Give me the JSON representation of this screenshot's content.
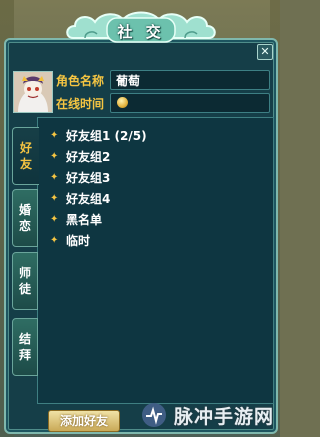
{
  "window": {
    "title": "社 交",
    "close_glyph": "✕"
  },
  "character": {
    "name_label": "角色名称",
    "name_value": "葡萄",
    "online_label": "在线时间"
  },
  "tabs": [
    {
      "label_top": "好",
      "label_bottom": "友",
      "active": true
    },
    {
      "label_top": "婚",
      "label_bottom": "恋",
      "active": false
    },
    {
      "label_top": "师",
      "label_bottom": "徒",
      "active": false
    },
    {
      "label_top": "结",
      "label_bottom": "拜",
      "active": false
    }
  ],
  "friend_groups": [
    {
      "label": "好友组1 (2/5)"
    },
    {
      "label": "好友组2"
    },
    {
      "label": "好友组3"
    },
    {
      "label": "好友组4"
    },
    {
      "label": "黑名单"
    },
    {
      "label": "临时"
    }
  ],
  "add_friend_button": "添加好友",
  "watermark": "脉冲手游网",
  "colors": {
    "panel_bg": "#153e48",
    "label_gold": "#f5c542",
    "border_teal": "#7fb8ad"
  }
}
